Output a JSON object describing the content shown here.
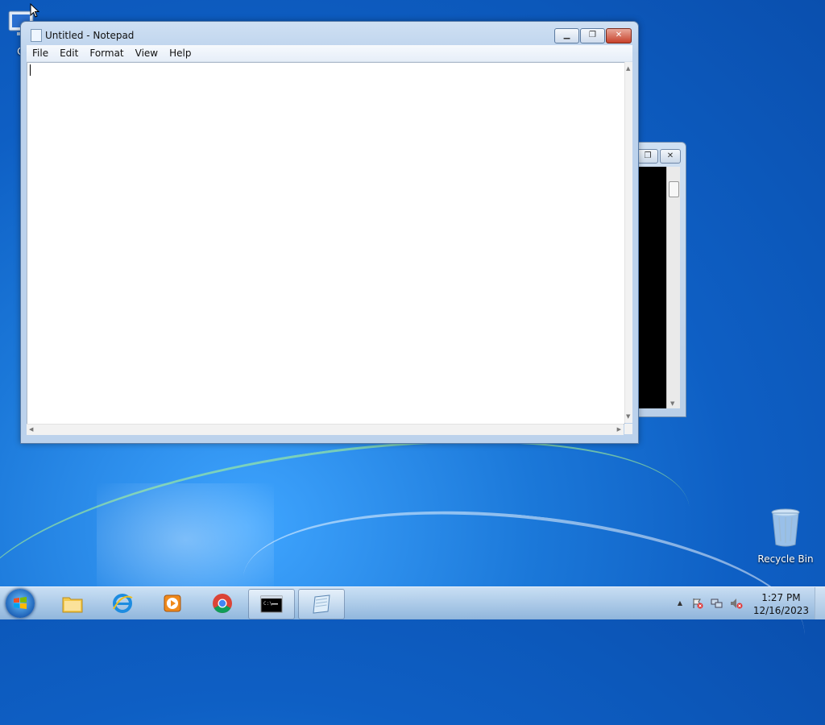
{
  "desktop": {
    "icons": [
      {
        "label": "Co",
        "icon": "computer-icon"
      },
      {
        "label": "Recycle Bin",
        "icon": "recycle-bin-icon"
      }
    ]
  },
  "console_window": {
    "icon": "command-prompt-icon",
    "close_label": "✕",
    "restore_label": "❐"
  },
  "notepad": {
    "title": "Untitled - Notepad",
    "menu": [
      "File",
      "Edit",
      "Format",
      "View",
      "Help"
    ],
    "content": "",
    "minimize_label": "▁",
    "maximize_label": "❐",
    "close_label": "✕"
  },
  "taskbar": {
    "pinned": [
      {
        "name": "start-button",
        "icon": "windows-flag-icon"
      },
      {
        "name": "file-explorer",
        "icon": "folder-icon"
      },
      {
        "name": "internet-explorer",
        "icon": "ie-icon"
      },
      {
        "name": "media-player",
        "icon": "media-player-icon"
      },
      {
        "name": "chrome",
        "icon": "chrome-icon"
      },
      {
        "name": "command-prompt",
        "icon": "command-prompt-icon"
      },
      {
        "name": "notepad",
        "icon": "notepad-icon"
      }
    ],
    "tray": {
      "show_hidden": "▲",
      "clock_time": "1:27 PM",
      "clock_date": "12/16/2023"
    }
  },
  "colors": {
    "desktop_blue": "#1b78d9",
    "close_red": "#c7412b",
    "titlebar": "#bcd2ec"
  }
}
